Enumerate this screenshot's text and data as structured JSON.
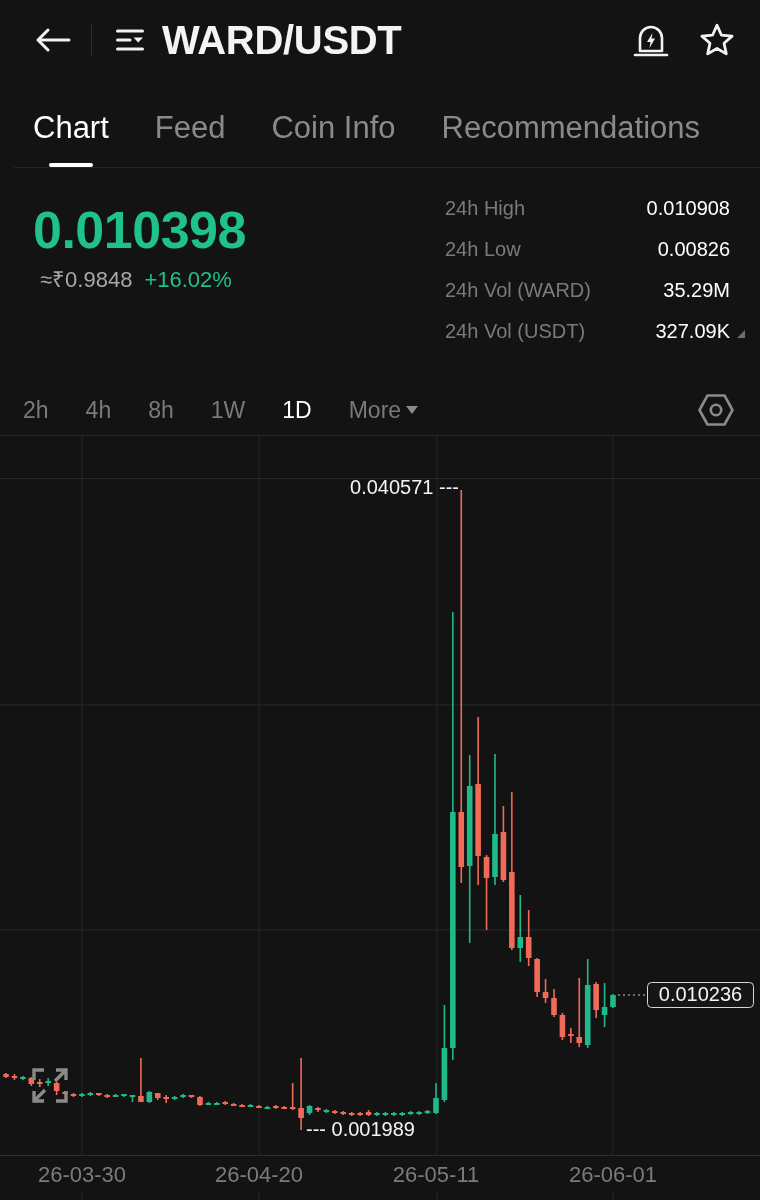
{
  "header": {
    "title": "WARD/USDT"
  },
  "tabs": [
    {
      "label": "Chart",
      "selected": true
    },
    {
      "label": "Feed",
      "selected": false
    },
    {
      "label": "Coin Info",
      "selected": false
    },
    {
      "label": "Recommendations",
      "selected": false
    }
  ],
  "ticker": {
    "price": "0.010398",
    "fiat": "≈₹0.9848",
    "change": "+16.02%",
    "up": true
  },
  "stats": [
    {
      "label": "24h High",
      "value": "0.010908",
      "hint": false
    },
    {
      "label": "24h Low",
      "value": "0.00826",
      "hint": false
    },
    {
      "label": "24h Vol (WARD)",
      "value": "35.29M",
      "hint": false
    },
    {
      "label": "24h Vol (USDT)",
      "value": "327.09K",
      "hint": true
    }
  ],
  "intervals": [
    {
      "label": "2h",
      "kind": "interval",
      "selected": false
    },
    {
      "label": "4h",
      "kind": "interval",
      "selected": false
    },
    {
      "label": "8h",
      "kind": "interval",
      "selected": false
    },
    {
      "label": "1W",
      "kind": "interval",
      "selected": false
    },
    {
      "label": "1D",
      "kind": "interval",
      "selected": true
    },
    {
      "label": "More",
      "kind": "menu",
      "selected": false
    }
  ],
  "chart": {
    "high_label": "0.040571 ---",
    "low_label": "--- 0.001989",
    "last_price": "0.010236",
    "dates": [
      "26-03-30",
      "26-04-20",
      "26-05-11",
      "26-06-01"
    ]
  }
}
